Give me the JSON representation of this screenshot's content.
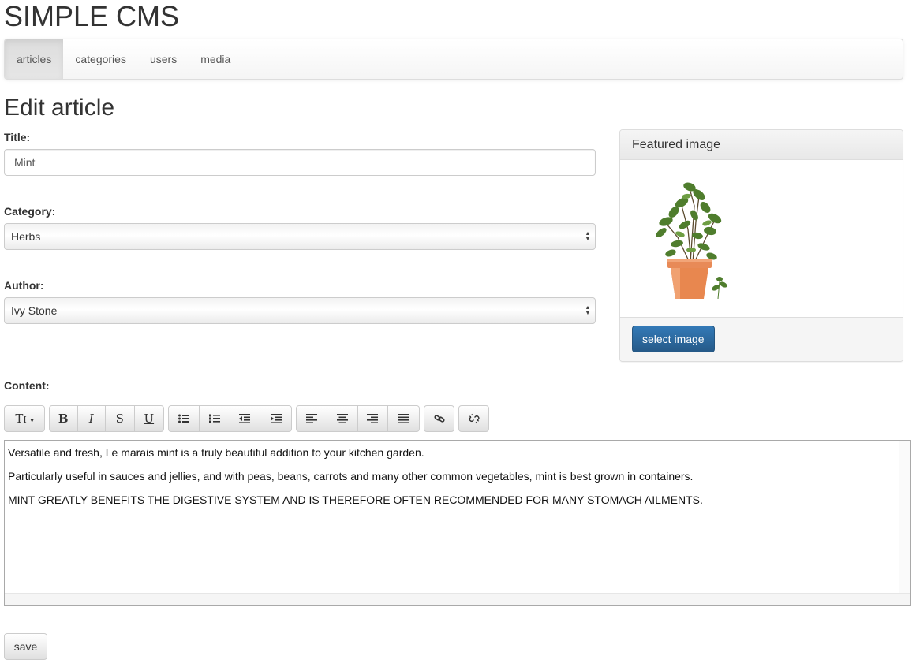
{
  "app": {
    "title": "SIMPLE CMS"
  },
  "nav": {
    "items": [
      {
        "label": "articles",
        "active": true
      },
      {
        "label": "categories"
      },
      {
        "label": "users"
      },
      {
        "label": "media"
      }
    ]
  },
  "page": {
    "title": "Edit article"
  },
  "form": {
    "title_label": "Title:",
    "title_value": "Mint",
    "category_label": "Category:",
    "category_value": "Herbs",
    "author_label": "Author:",
    "author_value": "Ivy Stone",
    "content_label": "Content:"
  },
  "featured": {
    "heading": "Featured image",
    "select_button": "select image",
    "image_icon": "potted-mint-plant"
  },
  "toolbar": {
    "font_size_label": "T",
    "bold_label": "B",
    "italic_label": "I",
    "strike_label": "S",
    "underline_label": "U",
    "icons": [
      "font-size-icon",
      "bold-icon",
      "italic-icon",
      "strikethrough-icon",
      "underline-icon",
      "bullet-list-icon",
      "numbered-list-icon",
      "outdent-icon",
      "indent-icon",
      "align-left-icon",
      "align-center-icon",
      "align-right-icon",
      "justify-icon",
      "link-icon",
      "unlink-icon"
    ]
  },
  "editor": {
    "paragraphs": [
      "Versatile and fresh, Le marais mint is a truly beautiful addition to your kitchen garden.",
      "Particularly useful in sauces and jellies, and with peas, beans, carrots and many other common vegetables, mint is best grown in containers.",
      "MINT GREATLY BENEFITS THE DIGESTIVE SYSTEM AND IS THEREFORE OFTEN RECOMMENDED FOR MANY STOMACH AILMENTS."
    ]
  },
  "actions": {
    "save_label": "save"
  },
  "colors": {
    "primary": "#337ab7",
    "pot": "#e88a57",
    "leaf": "#4f7d2d"
  }
}
